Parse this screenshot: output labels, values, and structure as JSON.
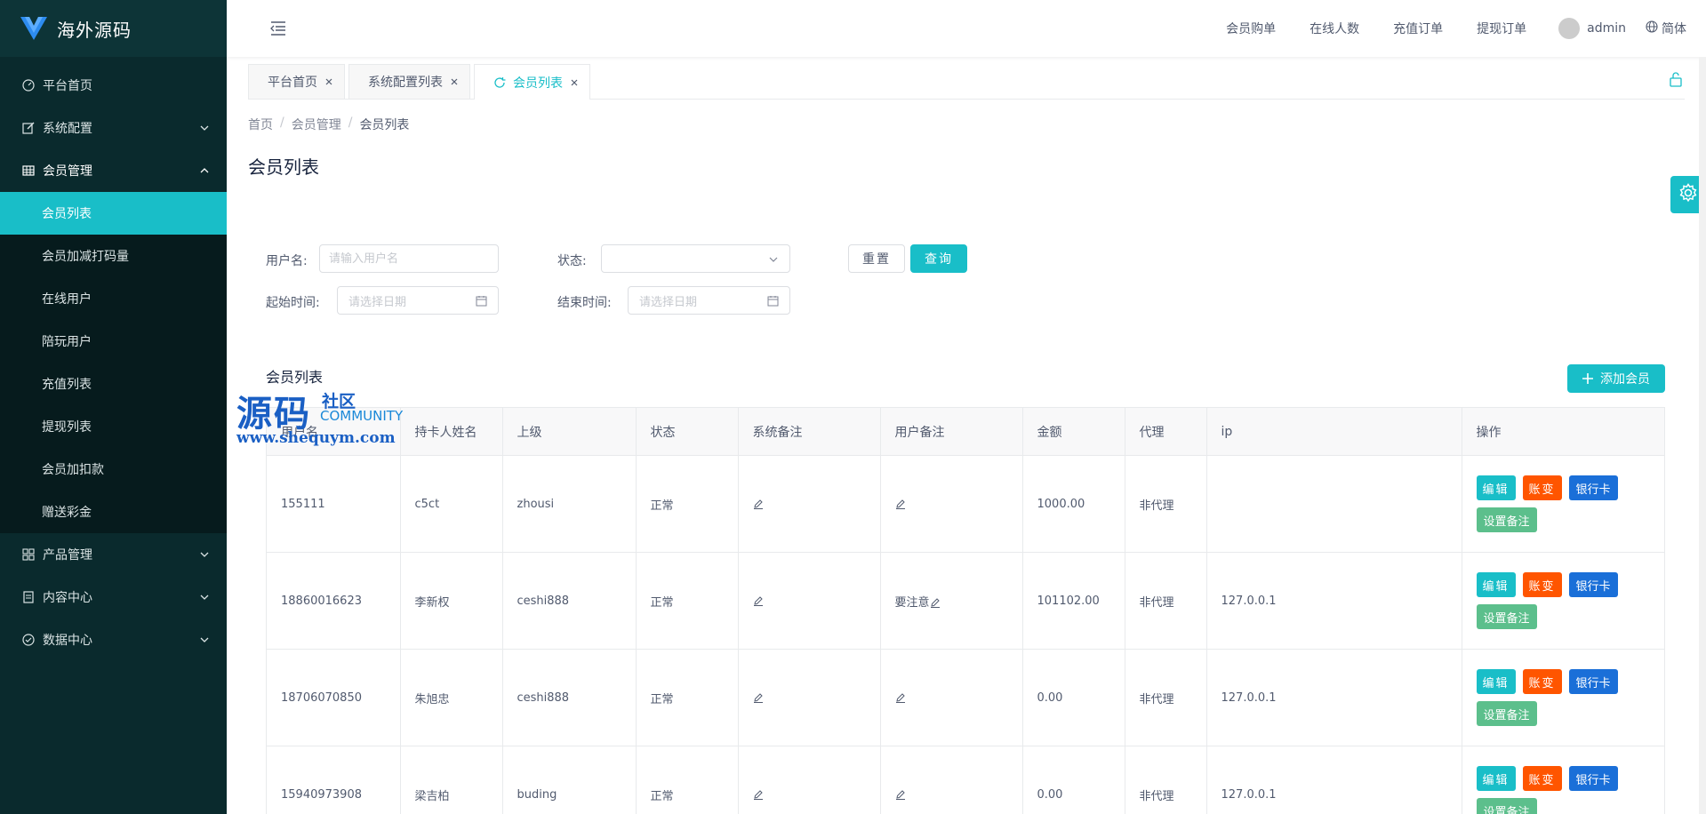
{
  "app": {
    "logo_text": "海外源码",
    "brand_color": "#19bec8"
  },
  "sidebar": {
    "items": [
      {
        "label": "平台首页",
        "icon": "dashboard-icon"
      },
      {
        "label": "系统配置",
        "icon": "edit-icon"
      },
      {
        "label": "会员管理",
        "icon": "table-icon"
      },
      {
        "label": "产品管理",
        "icon": "apps-icon"
      },
      {
        "label": "内容中心",
        "icon": "document-icon"
      },
      {
        "label": "数据中心",
        "icon": "check-circle-icon"
      }
    ],
    "sub_items": [
      {
        "label": "会员列表"
      },
      {
        "label": "会员加减打码量"
      },
      {
        "label": "在线用户"
      },
      {
        "label": "陪玩用户"
      },
      {
        "label": "充值列表"
      },
      {
        "label": "提现列表"
      },
      {
        "label": "会员加扣款"
      },
      {
        "label": "赠送彩金"
      }
    ]
  },
  "header": {
    "links": [
      "会员购单",
      "在线人数",
      "充值订单",
      "提现订单"
    ],
    "username": "admin",
    "language": "简体"
  },
  "tabs": [
    {
      "label": "平台首页"
    },
    {
      "label": "系统配置列表"
    },
    {
      "label": "会员列表"
    }
  ],
  "breadcrumb": [
    "首页",
    "会员管理",
    "会员列表"
  ],
  "page_title": "会员列表",
  "search": {
    "username_label": "用户名:",
    "username_placeholder": "请输入用户名",
    "status_label": "状态:",
    "start_label": "起始时间:",
    "start_placeholder": "请选择日期",
    "end_label": "结束时间:",
    "end_placeholder": "请选择日期",
    "reset_label": "重置",
    "query_label": "查询"
  },
  "list": {
    "title": "会员列表",
    "add_label": "添加会员",
    "columns": [
      "用户名",
      "持卡人姓名",
      "上级",
      "状态",
      "系统备注",
      "用户备注",
      "金额",
      "代理",
      "ip",
      "操作"
    ],
    "rows": [
      {
        "username": "155111",
        "holder": "c5ct",
        "parent": "zhousi",
        "status": "正常",
        "sys_note": "",
        "user_note": "",
        "amount": "1000.00",
        "agent": "非代理",
        "ip": ""
      },
      {
        "username": "18860016623",
        "holder": "李新权",
        "parent": "ceshi888",
        "status": "正常",
        "sys_note": "",
        "user_note": "要注意",
        "amount": "101102.00",
        "agent": "非代理",
        "ip": "127.0.0.1"
      },
      {
        "username": "18706070850",
        "holder": "朱旭忠",
        "parent": "ceshi888",
        "status": "正常",
        "sys_note": "",
        "user_note": "",
        "amount": "0.00",
        "agent": "非代理",
        "ip": "127.0.0.1"
      },
      {
        "username": "15940973908",
        "holder": "梁吉柏",
        "parent": "buding",
        "status": "正常",
        "sys_note": "",
        "user_note": "",
        "amount": "0.00",
        "agent": "非代理",
        "ip": "127.0.0.1"
      }
    ],
    "ops": {
      "edit": "编辑",
      "account": "账变",
      "bank": "银行卡",
      "note": "设置备注"
    }
  },
  "watermark": {
    "main": "源码",
    "sub1": "社区",
    "sub2": "COMMUNITY",
    "url": "www.shequym.com"
  }
}
